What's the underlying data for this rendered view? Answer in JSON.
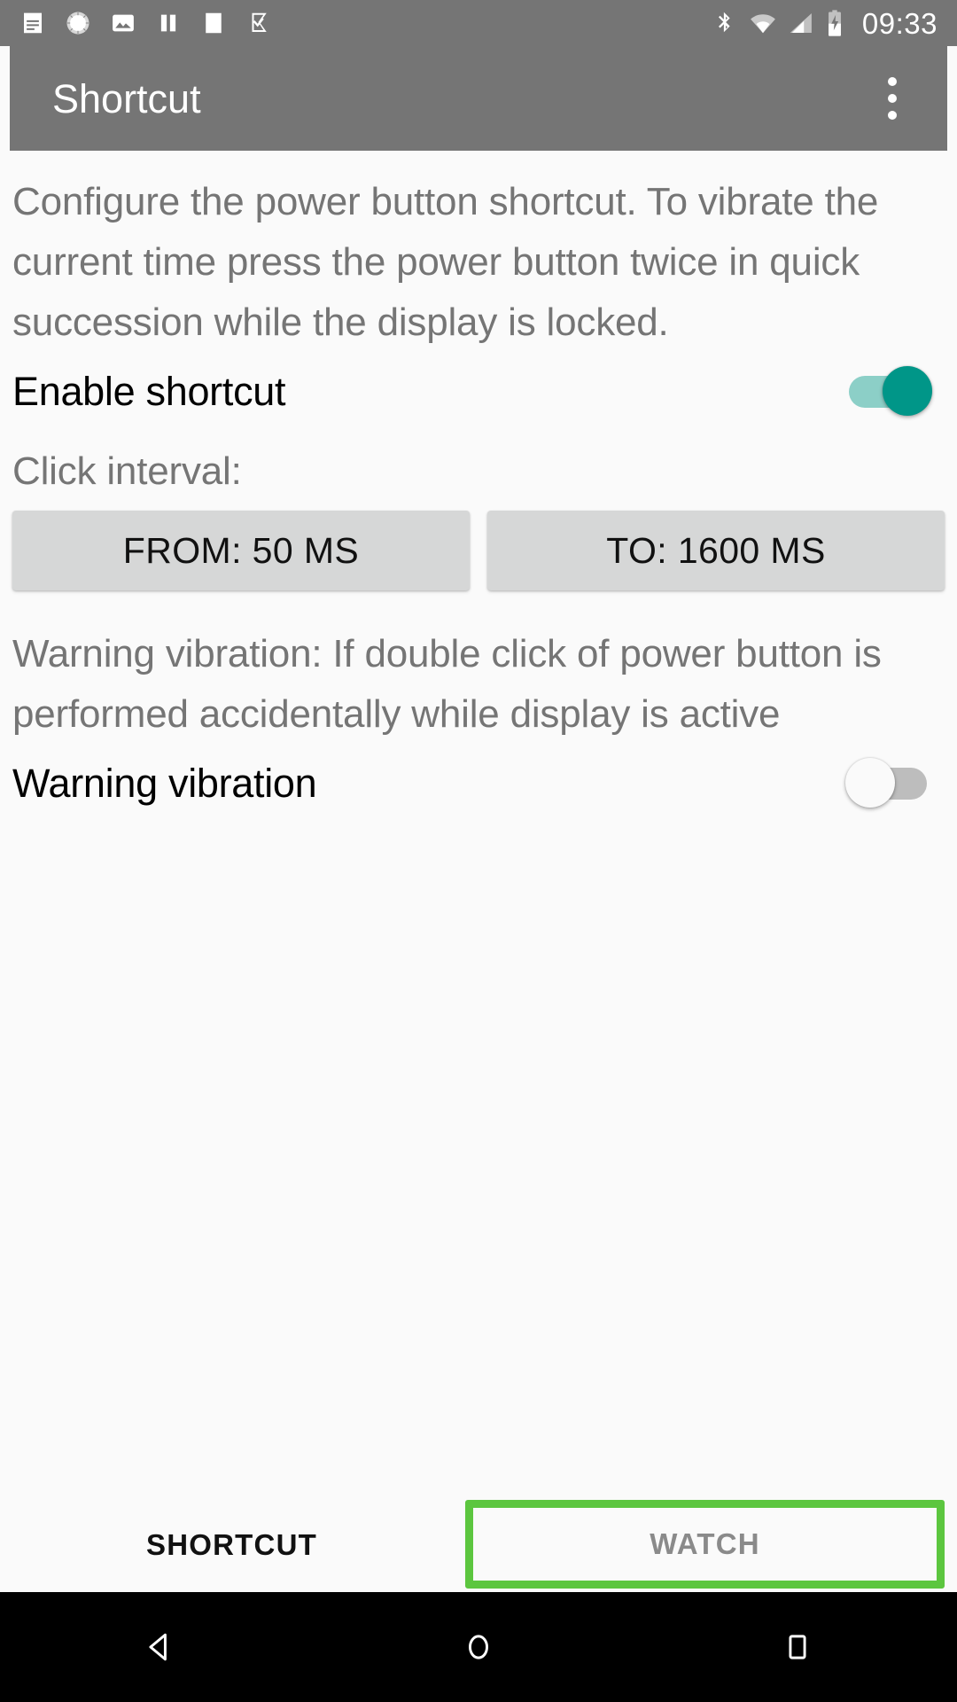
{
  "status_bar": {
    "time": "09:33",
    "left_icons": [
      {
        "name": "notes-icon",
        "label": "notes"
      },
      {
        "name": "sunburst-icon",
        "label": "sync"
      },
      {
        "name": "image-icon",
        "label": "screenshot"
      },
      {
        "name": "pause-icon",
        "label": "paused"
      },
      {
        "name": "blank-square-icon",
        "label": "notification"
      },
      {
        "name": "checkmark-flag-icon",
        "label": "tasks"
      }
    ],
    "right_icons": [
      {
        "name": "bluetooth-icon",
        "label": "bluetooth"
      },
      {
        "name": "wifi-icon",
        "label": "wifi"
      },
      {
        "name": "cellular-signal-icon",
        "label": "signal"
      },
      {
        "name": "battery-charging-icon",
        "label": "battery charging"
      }
    ]
  },
  "app_bar": {
    "title": "Shortcut",
    "overflow_label": "More options"
  },
  "main": {
    "description": "Configure the power button shortcut. To vibrate the current time press the power button twice in quick succession while the display is locked.",
    "enable_shortcut": {
      "label": "Enable shortcut",
      "state": "on"
    },
    "click_interval": {
      "label": "Click interval:",
      "from_button": "FROM: 50 MS",
      "to_button": "TO: 1600 MS",
      "from_value": 50,
      "to_value": 1600,
      "unit": "MS"
    },
    "warning_description": "Warning vibration: If double click of power button is performed accidentally while display is active",
    "warning_vibration": {
      "label": "Warning vibration",
      "state": "off"
    }
  },
  "tabs": [
    {
      "label": "SHORTCUT",
      "selected": true,
      "highlighted": false
    },
    {
      "label": "WATCH",
      "selected": false,
      "highlighted": true
    }
  ],
  "nav_bar": {
    "back": "Back",
    "home": "Home",
    "recents": "Recent apps"
  },
  "colors": {
    "app_bar": "#757575",
    "background": "#FAFAFA",
    "accent_on": "#009688",
    "accent_on_track": "#8CCFC7",
    "highlight_green": "#5CC63F",
    "button_fill": "#D6D7D7",
    "secondary_text": "#757575",
    "primary_text": "#000000",
    "nav_bar": "#000000"
  }
}
